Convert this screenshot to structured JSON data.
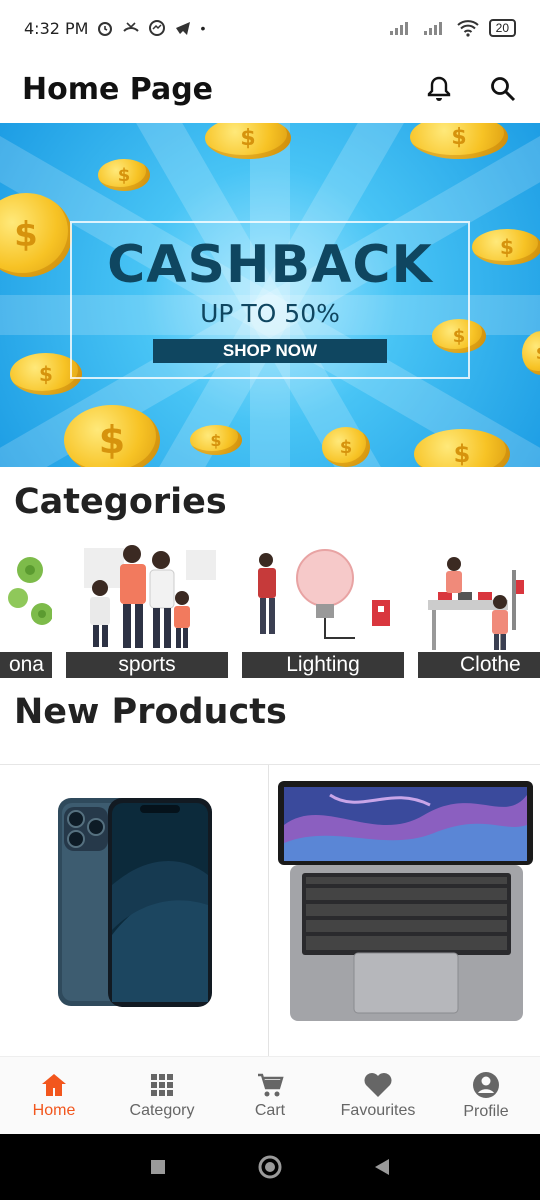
{
  "status_bar": {
    "time": "4:32 PM",
    "battery": "20",
    "icons": [
      "alarm-icon",
      "missed-call-icon",
      "messenger-icon",
      "telegram-icon",
      "dot-icon",
      "signal-icon",
      "signal-icon",
      "wifi-icon",
      "battery-icon"
    ]
  },
  "app_bar": {
    "title": "Home Page",
    "actions": [
      "bell-icon",
      "search-icon"
    ]
  },
  "banner": {
    "title": "CASHBACK",
    "subtitle": "UP TO 50%",
    "cta": "SHOP NOW",
    "coin_symbol": "$"
  },
  "categories": {
    "title": "Categories",
    "items": [
      {
        "label": "Corona",
        "visible_label": "ona"
      },
      {
        "label": "sports"
      },
      {
        "label": "Lighting"
      },
      {
        "label": "Clothe"
      }
    ]
  },
  "new_products": {
    "title": "New Products",
    "items": [
      {
        "name": "phone-product"
      },
      {
        "name": "laptop-product"
      }
    ]
  },
  "bottom_nav": {
    "items": [
      {
        "label": "Home",
        "icon": "home-icon",
        "active": true
      },
      {
        "label": "Category",
        "icon": "grid-icon",
        "active": false
      },
      {
        "label": "Cart",
        "icon": "cart-icon",
        "active": false
      },
      {
        "label": "Favourites",
        "icon": "heart-icon",
        "active": false
      },
      {
        "label": "Profile",
        "icon": "profile-icon",
        "active": false
      }
    ]
  },
  "colors": {
    "accent": "#f2561d",
    "banner_text": "#0f4660",
    "banner_blue": "#1d9de4"
  }
}
